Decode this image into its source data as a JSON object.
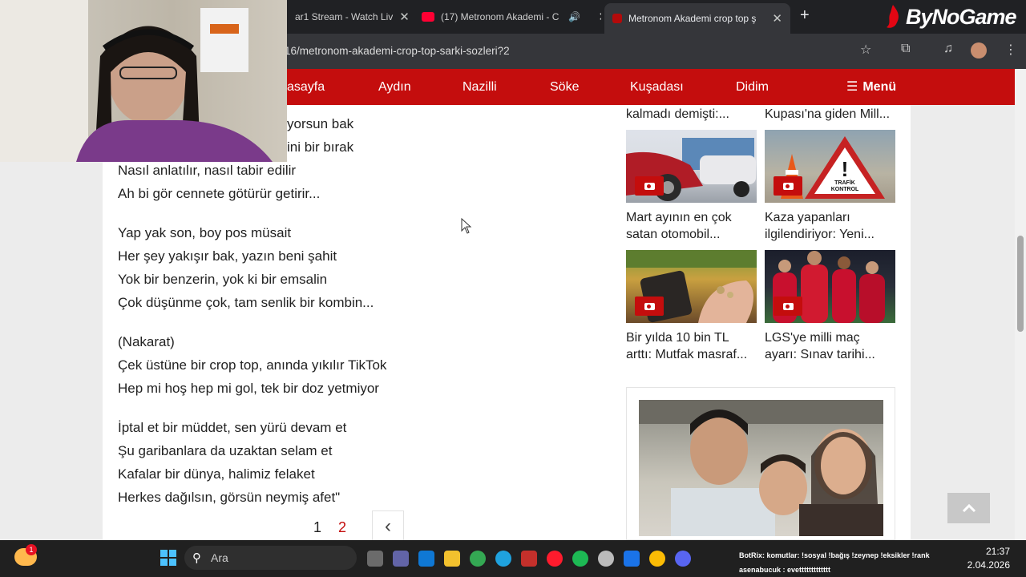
{
  "browser": {
    "tabs": [
      {
        "title": "ar1 Stream - Watch Liv"
      },
      {
        "title": "(17) Metronom Akademi - C"
      },
      {
        "title": "Metronom Akademi crop top ş"
      }
    ],
    "new_tab": "+",
    "url": "7816/metronom-akademi-crop-top-sarki-sozleri?2",
    "overlay_brand": "ByNoGame"
  },
  "nav": {
    "links": [
      "asayfa",
      "Aydın",
      "Nazilli",
      "Söke",
      "Kuşadası",
      "Didim"
    ],
    "menu_label": "Menü"
  },
  "lyrics": [
    "yorsun bak",
    "ini bir bırak",
    "Nasıl anlatılır, nasıl tabir edilir",
    "Ah bi gör cennete götürür getirir...",
    "Yap yak son, boy pos müsait",
    "Her şey yakışır bak, yazın beni şahit",
    "Yok bir benzerin, yok ki bir emsalin",
    "Çok düşünme çok, tam senlik bir kombin...",
    "(Nakarat)",
    "Çek üstüne bir crop top, anında yıkılır TikTok",
    "Hep mi hoş hep mi gol, tek bir doz yetmiyor",
    "İptal et bir müddet, sen yürü devam et",
    "Şu garibanlara da uzaktan selam et",
    "Kafalar bir dünya, halimiz felaket",
    "Herkes dağılsın, görsün neymiş afet\""
  ],
  "pagination": {
    "pages": [
      "1",
      "2"
    ],
    "prev_icon": "‹"
  },
  "sidebar": {
    "top_titles": [
      "kalmadı demişti:...",
      "Kupası'na giden Mill..."
    ],
    "cards": [
      {
        "l1": "Mart ayının en çok",
        "l2": "satan otomobil..."
      },
      {
        "l1": "Kaza yapanları",
        "l2": "ilgilendiriyor: Yeni..."
      },
      {
        "l1": "Bir yılda 10 bin TL",
        "l2": "arttı: Mutfak masraf..."
      },
      {
        "l1": "LGS'ye milli maç",
        "l2": "ayarı: Sınav tarihi..."
      }
    ],
    "traffic_sign": {
      "line1": "TRAFİK",
      "line2": "KONTROL"
    }
  },
  "taskbar": {
    "weather_badge": "1",
    "search_placeholder": "Ara",
    "chat_line1": "BotRix: komutlar: !sosyal !bağış !zeynep !eksikler !rank",
    "chat_line2": "asenabucuk : evettttttttttttt",
    "time": "21:37",
    "date": "2.04.2026"
  }
}
